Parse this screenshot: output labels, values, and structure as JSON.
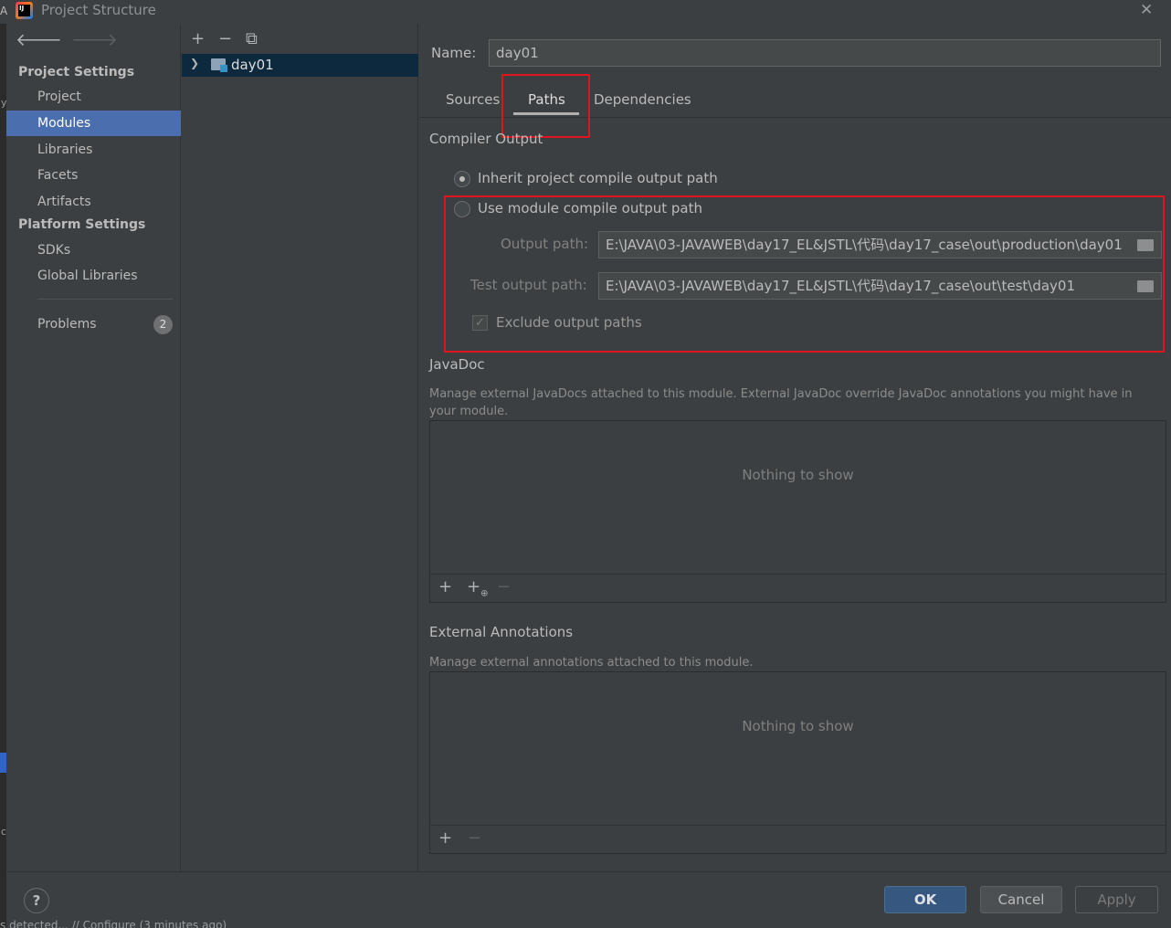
{
  "window": {
    "title": "Project Structure",
    "edge_letter": "A"
  },
  "nav": {
    "project_settings_label": "Project Settings",
    "project_items": [
      {
        "label": "Project"
      },
      {
        "label": "Modules",
        "selected": true
      },
      {
        "label": "Libraries"
      },
      {
        "label": "Facets"
      },
      {
        "label": "Artifacts"
      }
    ],
    "platform_settings_label": "Platform Settings",
    "platform_items": [
      {
        "label": "SDKs"
      },
      {
        "label": "Global Libraries"
      }
    ],
    "problems": {
      "label": "Problems",
      "count": "2"
    }
  },
  "module_tree": {
    "toolbar": {
      "add": "+",
      "remove": "−",
      "copy": "⧉"
    },
    "items": [
      {
        "label": "day01"
      }
    ]
  },
  "module": {
    "name_label": "Name:",
    "name_value": "day01",
    "tabs": [
      {
        "label": "Sources",
        "active": false
      },
      {
        "label": "Paths",
        "active": true
      },
      {
        "label": "Dependencies",
        "active": false
      }
    ],
    "compiler_output": {
      "title": "Compiler Output",
      "inherit_label": "Inherit project compile output path",
      "inherit_selected": true,
      "use_module_label": "Use module compile output path",
      "use_module_selected": false,
      "output_path_label": "Output path:",
      "output_path_value": "E:\\JAVA\\03-JAVAWEB\\day17_EL&JSTL\\代码\\day17_case\\out\\production\\day01",
      "test_output_path_label": "Test output path:",
      "test_output_path_value": "E:\\JAVA\\03-JAVAWEB\\day17_EL&JSTL\\代码\\day17_case\\out\\test\\day01",
      "exclude_label": "Exclude output paths",
      "exclude_checked": true
    },
    "javadoc": {
      "title": "JavaDoc",
      "description": "Manage external JavaDocs attached to this module. External JavaDoc override JavaDoc annotations you might have in your module.",
      "empty_text": "Nothing to show"
    },
    "external_annotations": {
      "title": "External Annotations",
      "description": "Manage external annotations attached to this module.",
      "empty_text": "Nothing to show"
    }
  },
  "footer": {
    "help": "?",
    "ok": "OK",
    "cancel": "Cancel",
    "apply": "Apply"
  },
  "background_status": "s detected... // Configure (3 minutes ago)",
  "colors": {
    "background": "#3c3f41",
    "selection": "#4b6eaf",
    "highlight_box": "#e0141e",
    "primary_button": "#365880"
  }
}
